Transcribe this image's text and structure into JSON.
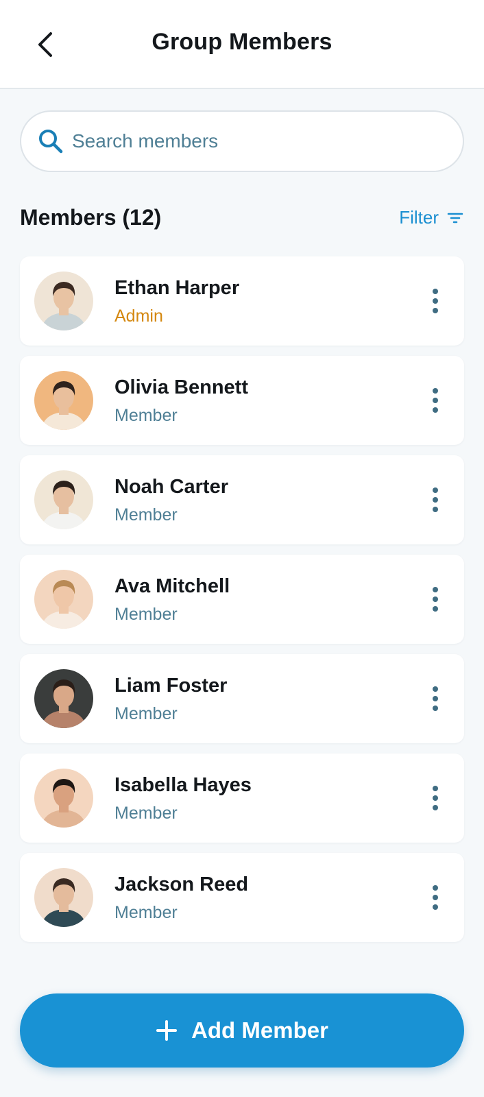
{
  "header": {
    "title": "Group Members",
    "back_icon": "chevron-left-icon"
  },
  "search": {
    "placeholder": "Search members",
    "value": "",
    "icon": "search-icon"
  },
  "section": {
    "title": "Members (12)",
    "filter_label": "Filter",
    "filter_icon": "filter-lines-icon"
  },
  "members": [
    {
      "name": "Ethan Harper",
      "role": "Admin",
      "avatar_bg": "#efe4d6",
      "skin": "#e8c3a3",
      "hair": "#3b2a22",
      "shirt": "#c9d3d6"
    },
    {
      "name": "Olivia Bennett",
      "role": "Member",
      "avatar_bg": "#f0b77f",
      "skin": "#e9bf9c",
      "hair": "#2f231d",
      "shirt": "#f5e8d8"
    },
    {
      "name": "Noah Carter",
      "role": "Member",
      "avatar_bg": "#f0e6d6",
      "skin": "#e6bfa0",
      "hair": "#2c211b",
      "shirt": "#f3f3f1"
    },
    {
      "name": "Ava Mitchell",
      "role": "Member",
      "avatar_bg": "#f3d6bf",
      "skin": "#efc7a8",
      "hair": "#b98a55",
      "shirt": "#f7ece2"
    },
    {
      "name": "Liam Foster",
      "role": "Member",
      "avatar_bg": "#3a3d3c",
      "skin": "#d9a888",
      "hair": "#2a1e18",
      "shirt": "#b6826a"
    },
    {
      "name": "Isabella Hayes",
      "role": "Member",
      "avatar_bg": "#f4d6bf",
      "skin": "#d9a17f",
      "hair": "#1e1714",
      "shirt": "#e2b595"
    },
    {
      "name": "Jackson Reed",
      "role": "Member",
      "avatar_bg": "#f0dccb",
      "skin": "#e4bb9c",
      "hair": "#3a2a22",
      "shirt": "#2f4a55"
    }
  ],
  "more_icon": "more-vertical-icon",
  "add_button": {
    "label": "Add Member",
    "icon": "plus-icon"
  },
  "colors": {
    "accent": "#1992d4",
    "admin_role": "#d4870e",
    "member_role": "#4f7f95",
    "background": "#f5f8fa"
  }
}
